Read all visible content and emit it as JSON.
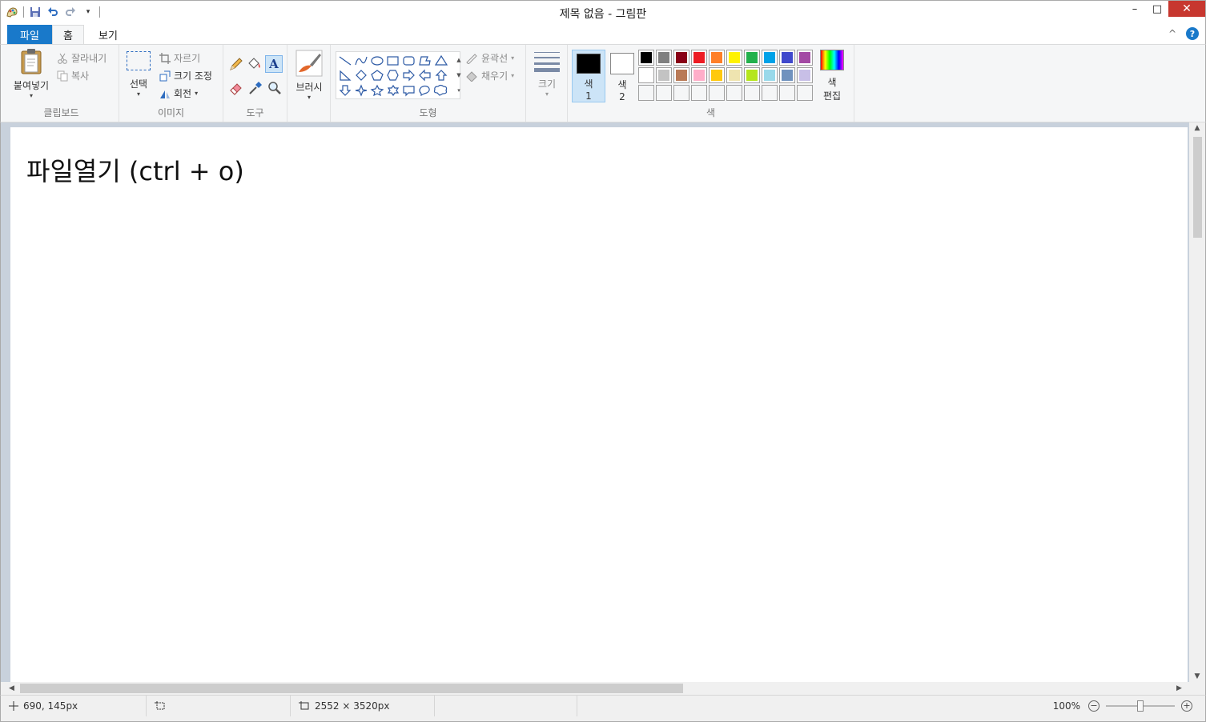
{
  "window": {
    "title": "제목 없음 - 그림판",
    "minimize": "–",
    "maximize": "□",
    "close": "✕"
  },
  "tabs": {
    "file": "파일",
    "home": "홈",
    "view": "보기",
    "collapse": "^",
    "help": "?"
  },
  "clipboard": {
    "paste": "붙여넣기",
    "cut": "잘라내기",
    "copy": "복사",
    "group": "클립보드"
  },
  "image": {
    "select": "선택",
    "crop": "자르기",
    "resize": "크기 조정",
    "rotate": "회전",
    "group": "이미지"
  },
  "tools": {
    "group": "도구"
  },
  "brushes": {
    "label": "브러시"
  },
  "shapes": {
    "outline": "윤곽선",
    "fill": "채우기",
    "group": "도형"
  },
  "size": {
    "label": "크기"
  },
  "colors": {
    "color1": "색",
    "color1_num": "1",
    "color2": "색",
    "color2_num": "2",
    "edit_line1": "색",
    "edit_line2": "편집",
    "group": "색",
    "color1_value": "#000000",
    "color2_value": "#ffffff",
    "palette": [
      "#000000",
      "#7f7f7f",
      "#880015",
      "#ed1c24",
      "#ff7f27",
      "#fff200",
      "#22b14c",
      "#00a2e8",
      "#3f48cc",
      "#a349a4",
      "#ffffff",
      "#c3c3c3",
      "#b97a57",
      "#ffaec9",
      "#ffc90e",
      "#efe4b0",
      "#b5e61d",
      "#99d9ea",
      "#7092be",
      "#c8bfe7"
    ],
    "custom_slots": 10
  },
  "canvas": {
    "text": "파일열기 (ctrl + o)"
  },
  "status": {
    "cursor_pos": "690, 145px",
    "image_size": "2552 × 3520px",
    "zoom": "100%",
    "zoom_level": 0.5
  }
}
